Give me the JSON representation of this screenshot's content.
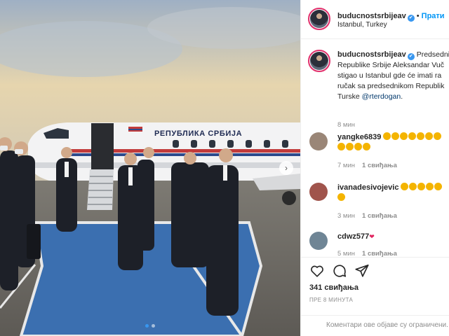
{
  "post": {
    "account": "buducnostsrbijeav",
    "verified_mark": "✔",
    "follow_label": "Прати",
    "separator": "•",
    "location": "Istanbul, Turkey",
    "aircraft_text": "РЕПУБЛИКА СРБИЈА",
    "next_arrow": "›",
    "carousel": {
      "count": 2,
      "active": 0
    }
  },
  "caption": {
    "username": "buducnostsrbijeav",
    "lines": [
      "Predsednik",
      "Republike Srbije Aleksandar Vuč",
      "stigao u Istanbul gde će imati ra",
      "ručak sa predsednikom Republik",
      "Turske "
    ],
    "mention": "@rterdogan",
    "tail": ".",
    "time": "8 мин"
  },
  "comments": [
    {
      "username": "yangke6839",
      "emoji_count": 11,
      "time": "7 мин",
      "likes": "1 свиђања"
    },
    {
      "username": "ivanadesivojevic",
      "emoji_count": 6,
      "time": "3 мин",
      "likes": "1 свиђања"
    },
    {
      "username": "cdwz577",
      "heart": "❤",
      "time": "5 мин",
      "likes": "1 свиђања"
    }
  ],
  "actions": {
    "like_icon": "heart-icon",
    "comment_icon": "comment-icon",
    "share_icon": "send-icon",
    "likes_count": "341 свиђања",
    "time_ago": "ПРЕ 8 МИНУТА",
    "comments_closed": "Коментари ове објаве су ограничени."
  },
  "colors": {
    "accent": "#0095f6",
    "verified": "#3897f0",
    "mention": "#00376b",
    "muted": "#8e8e8e",
    "carpet": "#3b6fb0"
  }
}
